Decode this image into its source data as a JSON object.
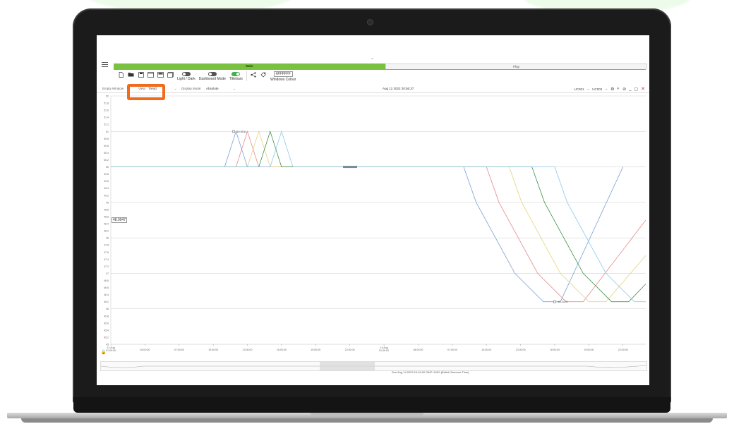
{
  "toolbar": {
    "light_dark_label": "Light / Dark",
    "dashboard_mode_label": "Dashboard Mode",
    "titlebars_label": "Titlebars",
    "windows_colour_label": "Windows Colour",
    "windows_colour_value": "#FFFFFF",
    "icons": [
      "new-file-icon",
      "open-folder-icon",
      "save-icon",
      "window-icon",
      "layout-icon",
      "layers-icon",
      "share-icon",
      "tag-icon"
    ]
  },
  "tabs": {
    "main": "Main",
    "play": "Play"
  },
  "controls": {
    "window_label": "Empty Window",
    "view_label": "View:",
    "view_value": "Trend",
    "display_mode_label": "Display Mode:",
    "display_mode_value": "Absolute",
    "timestamp": "Aug 12 2022 20:56:37",
    "utc_left": "UC001",
    "utc_right": "UC002"
  },
  "value_marker": "48.9047",
  "status_text": "Sun Aug 14 2022 10:40:00 GMT+0100 (British Summer Time)",
  "colors": {
    "accent": "#7ac142",
    "highlight": "#f26a1b",
    "close": "#d33333"
  },
  "chart_data": {
    "type": "line",
    "y_ticks": [
      "52",
      "51.8",
      "51.6",
      "51.4",
      "51.2",
      "51",
      "50.8",
      "50.6",
      "50.4",
      "50.2",
      "50",
      "49.8",
      "49.6",
      "49.4",
      "49.2",
      "49",
      "48.8",
      "48.6",
      "48.4",
      "48.2",
      "48",
      "47.8",
      "47.6",
      "47.4",
      "47.2",
      "47",
      "46.8",
      "46.6",
      "46.4",
      "46.2",
      "46",
      "45.8",
      "45.6",
      "45.4",
      "45.2",
      "45"
    ],
    "ylim": [
      45,
      52
    ],
    "x_ticks": [
      {
        "line1": "13 Aug",
        "line2": "01:00:00"
      },
      {
        "line1": "",
        "line2": "04:00:00"
      },
      {
        "line1": "",
        "line2": "07:00:00"
      },
      {
        "line1": "",
        "line2": "10:00:00"
      },
      {
        "line1": "",
        "line2": "13:00:00"
      },
      {
        "line1": "",
        "line2": "16:00:00"
      },
      {
        "line1": "",
        "line2": "19:00:00"
      },
      {
        "line1": "",
        "line2": "22:00:00"
      },
      {
        "line1": "14 Aug",
        "line2": "01:00:00"
      },
      {
        "line1": "",
        "line2": "04:00:00"
      },
      {
        "line1": "",
        "line2": "07:00:00"
      },
      {
        "line1": "",
        "line2": "10:00:00"
      },
      {
        "line1": "",
        "line2": "13:00:00"
      },
      {
        "line1": "",
        "line2": "16:00:00"
      },
      {
        "line1": "",
        "line2": "19:00:00"
      },
      {
        "line1": "",
        "line2": "22:00:00"
      }
    ],
    "annotations": [
      {
        "label": "50.0011",
        "x_hours": 10.8,
        "y": 51
      },
      {
        "label": "46.2025",
        "x_hours": 39.0,
        "y": 46.2
      }
    ],
    "series": [
      {
        "color": "#7aa0d6",
        "points": [
          [
            0,
            50
          ],
          [
            10,
            50
          ],
          [
            11,
            51
          ],
          [
            12,
            50
          ],
          [
            31,
            50
          ],
          [
            32.1,
            49
          ],
          [
            35.5,
            47
          ],
          [
            38,
            46.2
          ],
          [
            39.5,
            46.2
          ],
          [
            45,
            50
          ]
        ]
      },
      {
        "color": "#e58a8a",
        "points": [
          [
            0,
            50
          ],
          [
            11,
            50
          ],
          [
            12,
            51
          ],
          [
            13,
            50
          ],
          [
            33,
            50
          ],
          [
            34.1,
            49
          ],
          [
            37.5,
            47
          ],
          [
            40,
            46.2
          ],
          [
            41.5,
            46.2
          ],
          [
            47,
            48.5
          ]
        ]
      },
      {
        "color": "#e6d27a",
        "points": [
          [
            0,
            50
          ],
          [
            12,
            50
          ],
          [
            13,
            51
          ],
          [
            14,
            50
          ],
          [
            35,
            50
          ],
          [
            36.1,
            49
          ],
          [
            39.5,
            47
          ],
          [
            42,
            46.2
          ],
          [
            43.5,
            46.2
          ],
          [
            47,
            47.5
          ]
        ]
      },
      {
        "color": "#3f8f4a",
        "points": [
          [
            0,
            50
          ],
          [
            13,
            50
          ],
          [
            14,
            51
          ],
          [
            15,
            50
          ],
          [
            37,
            50
          ],
          [
            38.1,
            49
          ],
          [
            41.5,
            47
          ],
          [
            44,
            46.2
          ],
          [
            45.5,
            46.2
          ],
          [
            47,
            46.7
          ]
        ]
      },
      {
        "color": "#8cc8e8",
        "points": [
          [
            0,
            50
          ],
          [
            14,
            50
          ],
          [
            15,
            51
          ],
          [
            16,
            50
          ],
          [
            39,
            50
          ],
          [
            40.1,
            49
          ],
          [
            43.5,
            47
          ],
          [
            46,
            46.2
          ],
          [
            47,
            46.2
          ]
        ]
      }
    ]
  }
}
